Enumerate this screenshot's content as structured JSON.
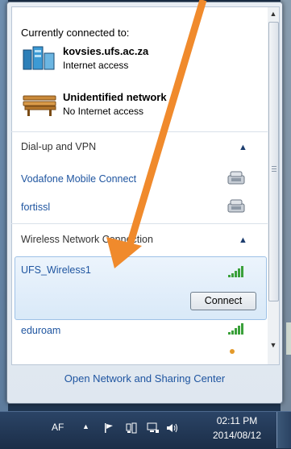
{
  "flyout": {
    "header": "Currently connected to:",
    "connected": [
      {
        "name": "kovsies.ufs.ac.za",
        "status": "Internet access",
        "icon": "domain-network-icon"
      },
      {
        "name": "Unidentified network",
        "status": "No Internet access",
        "icon": "bench-network-icon"
      }
    ],
    "sections": {
      "dialup": {
        "title": "Dial-up and VPN",
        "items": [
          "Vodafone Mobile Connect",
          "fortissl"
        ]
      },
      "wireless": {
        "title": "Wireless Network Connection"
      }
    },
    "wireless": {
      "selected": {
        "name": "UFS_Wireless1",
        "button": "Connect",
        "signal": 5
      },
      "others": [
        {
          "name": "eduroam",
          "signal": 5
        }
      ]
    },
    "footer": "Open Network and Sharing Center"
  },
  "taskbar": {
    "language": "AF",
    "time": "02:11 PM",
    "date": "2014/08/12"
  },
  "colors": {
    "arrow": "#f08a2c",
    "link": "#1f55a0",
    "signal": "#3aa03a"
  }
}
